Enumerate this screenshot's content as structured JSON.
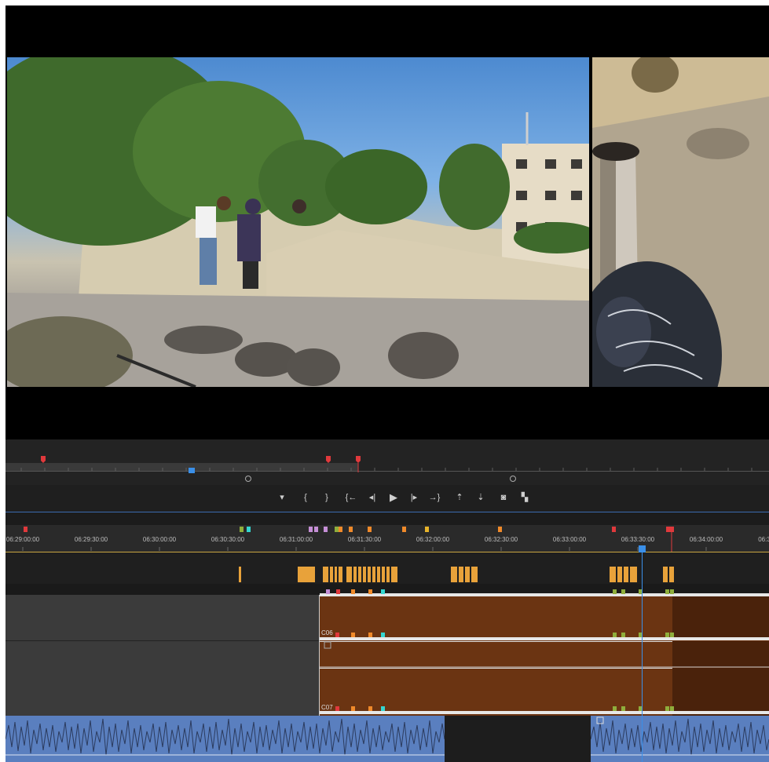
{
  "monitor": {
    "main_frame": "main-camera-frame",
    "side_frame": "secondary-camera-frame"
  },
  "transport": {
    "buttons": [
      {
        "name": "add-marker-button",
        "glyph": "▾"
      },
      {
        "name": "mark-in-button",
        "glyph": "{"
      },
      {
        "name": "mark-out-button",
        "glyph": "}"
      },
      {
        "name": "go-to-in-button",
        "glyph": "{←"
      },
      {
        "name": "step-back-button",
        "glyph": "◂|"
      },
      {
        "name": "play-button",
        "glyph": "▶"
      },
      {
        "name": "step-forward-button",
        "glyph": "|▸"
      },
      {
        "name": "go-to-out-button",
        "glyph": "→}"
      },
      {
        "name": "lift-button",
        "glyph": "⇡"
      },
      {
        "name": "extract-button",
        "glyph": "⇣"
      },
      {
        "name": "export-frame-button",
        "glyph": "◙"
      },
      {
        "name": "comparison-view-button",
        "glyph": "▚"
      }
    ]
  },
  "timeline": {
    "timecodes": [
      "06:29:00:00",
      "06:29:30:00",
      "06:30:00:00",
      "06:30:30:00",
      "06:31:00:00",
      "06:31:30:00",
      "06:32:00:00",
      "06:32:30:00",
      "06:33:00:00",
      "06:33:30:00",
      "06:34:00:00",
      "06:3"
    ],
    "clip_labels": [
      "C06",
      "C07"
    ]
  },
  "colors": {
    "accent": "#3a8fe8",
    "clip": "#6b3412",
    "marker_orange": "#e8a23a",
    "audio": "#5a7fbf"
  }
}
